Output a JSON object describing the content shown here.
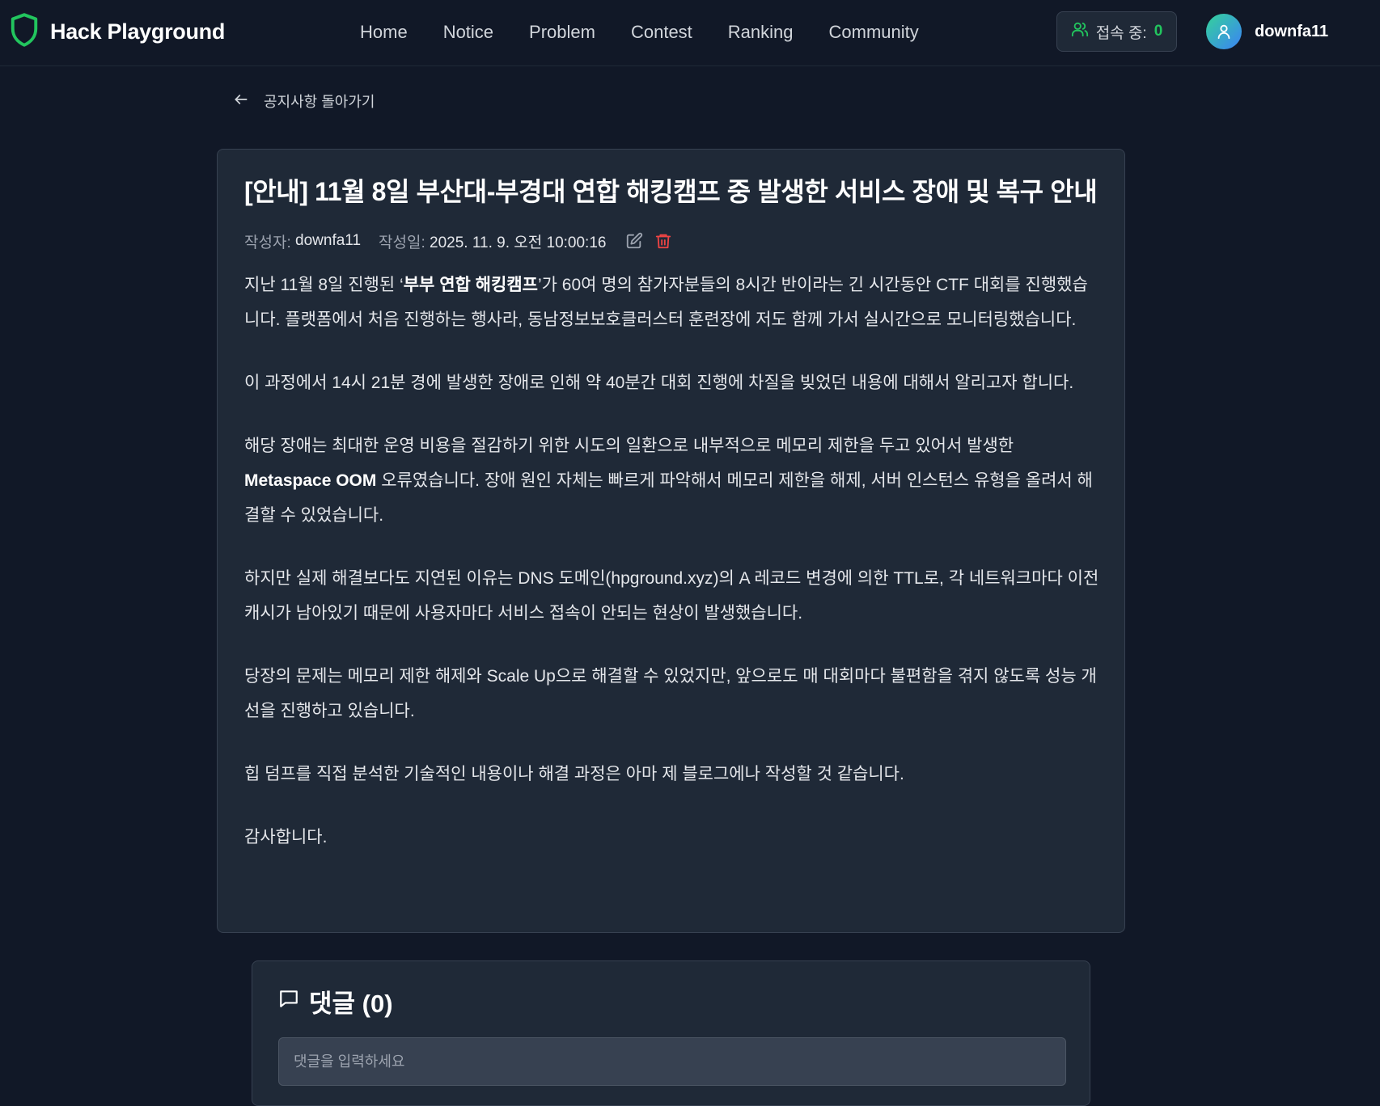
{
  "header": {
    "brand": "Hack Playground",
    "nav": [
      "Home",
      "Notice",
      "Problem",
      "Contest",
      "Ranking",
      "Community"
    ],
    "online_label": "접속 중:",
    "online_count": "0",
    "username": "downfa11"
  },
  "back_link": "공지사항 돌아가기",
  "post": {
    "title": "[안내] 11월 8일 부산대-부경대 연합 해킹캠프 중 발생한 서비스 장애 및 복구 안내",
    "author_label": "작성자:",
    "author": "downfa11",
    "date_label": "작성일:",
    "date": "2025. 11. 9. 오전 10:00:16",
    "p1_a": "지난 11월 8일 진행된 ‘",
    "p1_bold": "부부 연합 해킹캠프",
    "p1_b": "’가 60여 명의 참가자분들의 8시간 반이라는 긴 시간동안 CTF 대회를 진행했습니다. 플랫폼에서 처음 진행하는 행사라, 동남정보보호클러스터 훈련장에 저도 함께 가서 실시간으로 모니터링했습니다.",
    "p2": "이 과정에서 14시 21분 경에 발생한 장애로 인해 약 40분간 대회 진행에 차질을 빚었던 내용에 대해서 알리고자 합니다.",
    "p3_a": "해당 장애는 최대한 운영 비용을 절감하기 위한 시도의 일환으로 내부적으로 메모리 제한을 두고 있어서 발생한 ",
    "p3_bold": "Metaspace OOM",
    "p3_b": " 오류였습니다. 장애 원인 자체는 빠르게 파악해서 메모리 제한을 해제, 서버 인스턴스 유형을 올려서 해결할 수 있었습니다.",
    "p4": "하지만 실제 해결보다도 지연된 이유는 DNS 도메인(hpground.xyz)의 A 레코드 변경에 의한 TTL로, 각 네트워크마다 이전 캐시가 남아있기 때문에 사용자마다 서비스 접속이 안되는 현상이 발생했습니다.",
    "p5": "당장의 문제는 메모리 제한 해제와 Scale Up으로 해결할 수 있었지만, 앞으로도 매 대회마다 불편함을 겪지 않도록 성능 개선을 진행하고 있습니다.",
    "p6": "힙 덤프를 직접 분석한 기술적인 내용이나 해결 과정은 아마 제 블로그에나 작성할 것 같습니다.",
    "p7": "감사합니다."
  },
  "comments": {
    "title": "댓글 (0)",
    "placeholder": "댓글을 입력하세요"
  },
  "colors": {
    "background": "#111827",
    "card": "#1f2937",
    "accent_green": "#22c55e",
    "delete_red": "#ef4444"
  },
  "icons": {
    "brand": "shield-icon",
    "online": "users-icon",
    "avatar": "user-icon",
    "back": "arrow-left-icon",
    "edit": "edit-icon",
    "delete": "trash-icon",
    "comments": "message-icon"
  }
}
